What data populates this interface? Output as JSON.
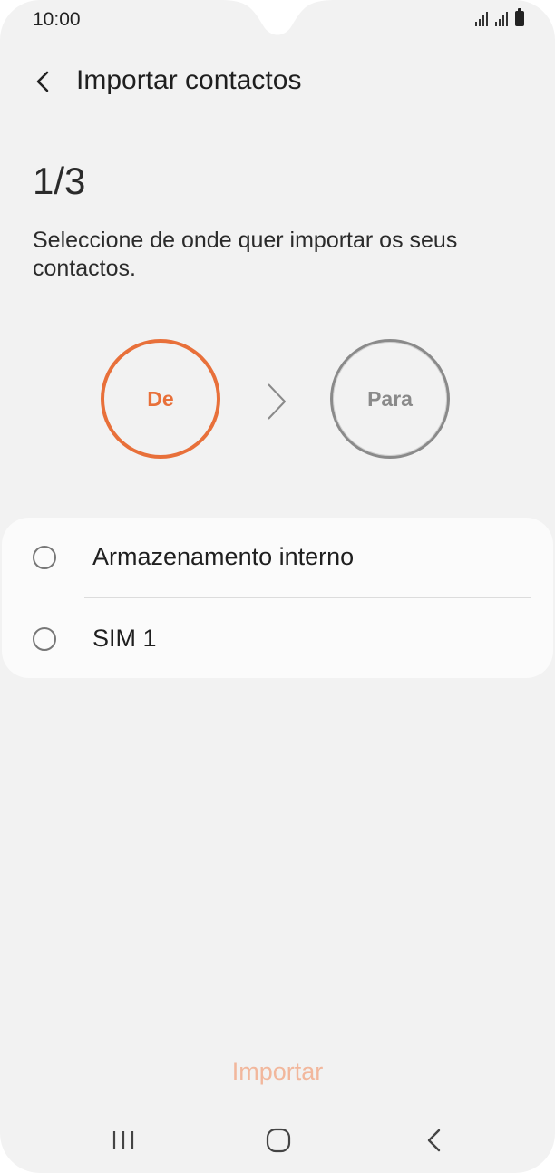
{
  "status_bar": {
    "time": "10:00",
    "icons": [
      "signal-sim1-icon",
      "signal-sim2-icon",
      "battery-icon"
    ]
  },
  "header": {
    "back_icon": "back-arrow-icon",
    "title": "Importar contactos"
  },
  "step": {
    "label": "1/3"
  },
  "instruction": "Seleccione de onde quer importar os seus contactos.",
  "flow": {
    "from_label": "De",
    "to_label": "Para",
    "arrow_icon": "chevron-right-icon",
    "from_color": "#e8703a",
    "to_color": "#8a8a8a"
  },
  "sources": {
    "items": [
      {
        "label": "Armazenamento interno",
        "selected": false
      },
      {
        "label": "SIM 1",
        "selected": false
      }
    ]
  },
  "actions": {
    "import_label": "Importar",
    "import_color": "#f2b79c",
    "import_enabled": false
  },
  "nav_bar": {
    "icons": [
      "recents-icon",
      "home-icon",
      "back-icon"
    ]
  },
  "colors": {
    "accent": "#e8703a",
    "background": "#f2f2f2",
    "card": "#fbfbfb"
  }
}
